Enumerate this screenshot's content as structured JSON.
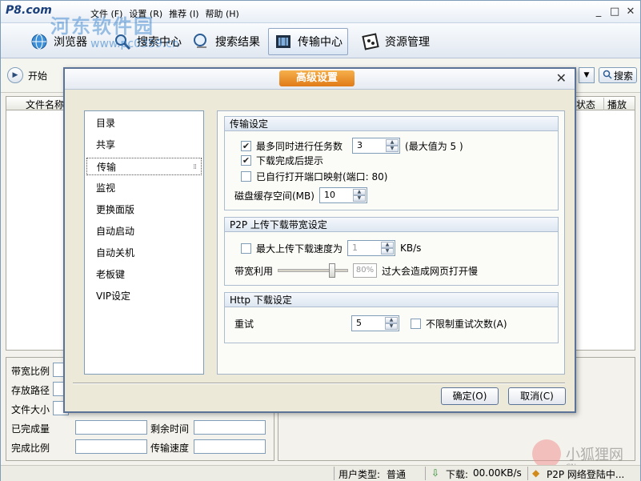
{
  "app": {
    "logo": "P8.com",
    "menu": [
      "文件 (F)",
      "设置 (R)",
      "推荐 (I)",
      "帮助 (H)"
    ],
    "window_buttons": [
      "_",
      "□",
      "✕"
    ]
  },
  "watermark": {
    "text": "河东软件园",
    "url": "www.pc0359.cn"
  },
  "nav": {
    "tabs": [
      {
        "label": "浏览器",
        "icon": "browser-icon"
      },
      {
        "label": "搜索中心",
        "icon": "search-center-icon"
      },
      {
        "label": "搜索结果",
        "icon": "search-results-icon"
      },
      {
        "label": "传输中心",
        "icon": "transfer-center-icon"
      },
      {
        "label": "资源管理",
        "icon": "resource-manager-icon"
      }
    ],
    "active": "传输中心"
  },
  "toolbar": {
    "start_label": "开始",
    "search_label": "搜索"
  },
  "list": {
    "columns": [
      "文件名称",
      "状态",
      "播放"
    ]
  },
  "info": {
    "bandwidth_ratio": "带宽比例",
    "save_path": "存放路径",
    "file_size": "文件大小",
    "completed": "已完成量",
    "remaining_time": "剩余时间",
    "completion_ratio": "完成比例",
    "transfer_speed": "传输速度"
  },
  "status": {
    "user_type_label": "用户类型:",
    "user_type": "普通",
    "download_label": "下载:",
    "download_speed": "00.00KB/s",
    "p2p_status": "P2P 网络登陆中..."
  },
  "fox_watermark": {
    "text": "小狐狸网",
    "url": "CN"
  },
  "dialog": {
    "title": "高级设置",
    "close": "✕",
    "categories": [
      "目录",
      "共享",
      "传输",
      "监视",
      "更换面版",
      "自动启动",
      "自动关机",
      "老板键",
      "VIP设定"
    ],
    "selected_category": "传输",
    "transfer": {
      "header": "传输设定",
      "max_tasks_label": "最多同时进行任务数",
      "max_tasks_value": "3",
      "max_tasks_hint": "(最大值为 5 )",
      "max_tasks_checked": true,
      "notify_label": "下载完成后提示",
      "notify_checked": true,
      "port_label": "已自行打开端口映射(端口: 80)",
      "port_checked": false,
      "cache_label": "磁盘缓存空间(MB)",
      "cache_value": "10"
    },
    "p2p": {
      "header": "P2P 上传下载带宽设定",
      "max_speed_label": "最大上传下载速度为",
      "max_speed_value": "1",
      "max_speed_unit": "KB/s",
      "max_speed_checked": false,
      "bandwidth_label": "带宽利用",
      "bandwidth_percent": "80%",
      "bandwidth_level": 0.8,
      "bandwidth_hint": "过大会造成网页打开慢"
    },
    "http": {
      "header": "Http 下载设定",
      "retry_label": "重试",
      "retry_value": "5",
      "unlimited_label": "不限制重试次数(A)",
      "unlimited_checked": false
    },
    "ok_label": "确定(O)",
    "cancel_label": "取消(C)"
  }
}
